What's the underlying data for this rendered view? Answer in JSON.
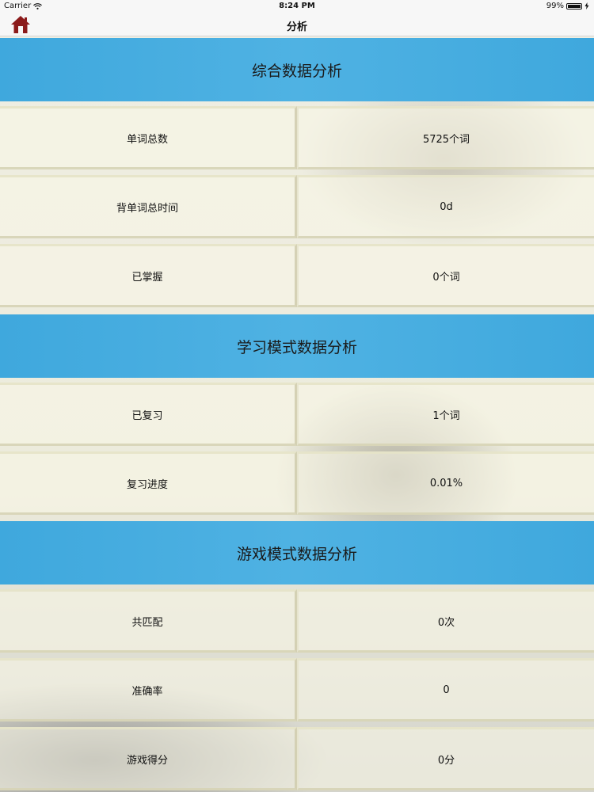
{
  "status_bar": {
    "carrier": "Carrier",
    "time": "8:24 PM",
    "battery_percent": "99%",
    "battery_level": 0.99
  },
  "nav": {
    "title": "分析",
    "home_icon": "home-icon"
  },
  "sections": [
    {
      "title": "综合数据分析",
      "rows": [
        {
          "label": "单词总数",
          "value": "5725个词"
        },
        {
          "label": "背单词总时间",
          "value": "0d"
        },
        {
          "label": "已掌握",
          "value": "0个词"
        }
      ]
    },
    {
      "title": "学习模式数据分析",
      "rows": [
        {
          "label": "已复习",
          "value": "1个词"
        },
        {
          "label": "复习进度",
          "value": "0.01%"
        }
      ]
    },
    {
      "title": "游戏模式数据分析",
      "rows": [
        {
          "label": "共匹配",
          "value": "0次"
        },
        {
          "label": "准确率",
          "value": "0"
        },
        {
          "label": "游戏得分",
          "value": "0分"
        }
      ]
    }
  ],
  "colors": {
    "section_header": "#4fb2e3",
    "home_icon": "#8b1a1a"
  }
}
